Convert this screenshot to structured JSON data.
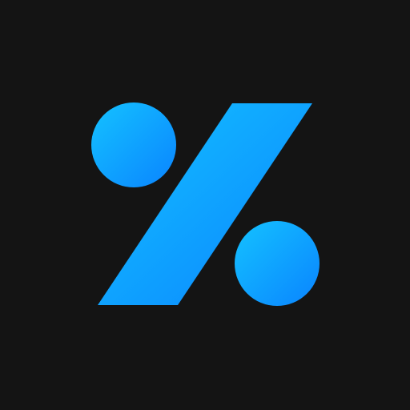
{
  "app_icon": {
    "icon_name": "percent-icon",
    "colors": {
      "background": "#141414",
      "gradient_start": "#14C2FF",
      "gradient_end": "#0A84FF"
    }
  }
}
